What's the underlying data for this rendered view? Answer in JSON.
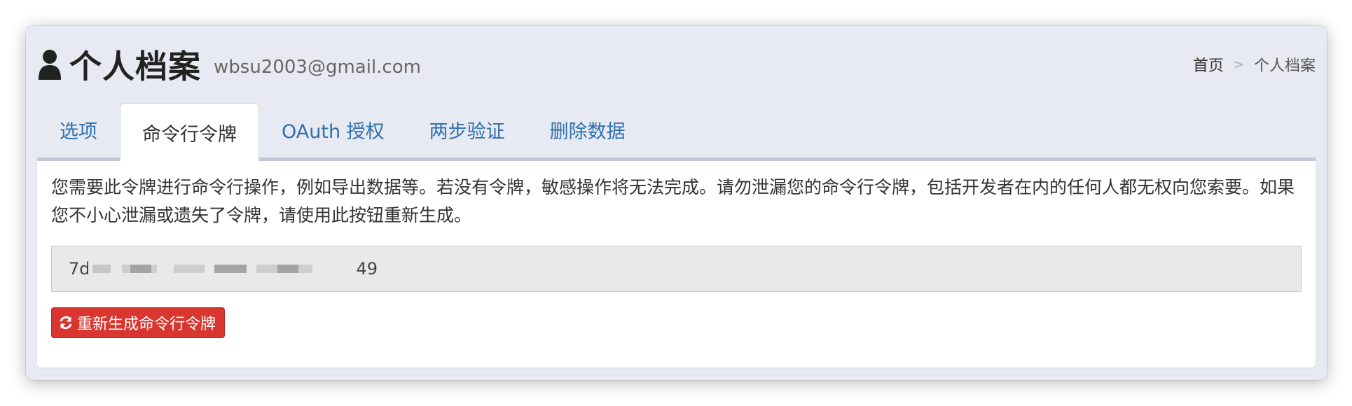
{
  "header": {
    "title": "个人档案",
    "email": "wbsu2003@gmail.com",
    "icon": "user-icon"
  },
  "breadcrumb": {
    "home": "首页",
    "separator": ">",
    "current": "个人档案"
  },
  "tabs": [
    {
      "label": "选项",
      "active": false
    },
    {
      "label": "命令行令牌",
      "active": true
    },
    {
      "label": "OAuth 授权",
      "active": false
    },
    {
      "label": "两步验证",
      "active": false
    },
    {
      "label": "删除数据",
      "active": false
    }
  ],
  "panel": {
    "description": "您需要此令牌进行命令行操作，例如导出数据等。若没有令牌，敏感操作将无法完成。请勿泄漏您的命令行令牌，包括开发者在内的任何人都无权向您索要。如果您不小心泄漏或遗失了令牌，请使用此按钮重新生成。",
    "token_visible_prefix": "7d",
    "token_visible_suffix": "49",
    "regenerate_label": "重新生成命令行令牌",
    "regenerate_icon": "refresh-icon"
  },
  "colors": {
    "link": "#2f6fad",
    "danger": "#d9362f",
    "background": "#e8eaf3"
  }
}
